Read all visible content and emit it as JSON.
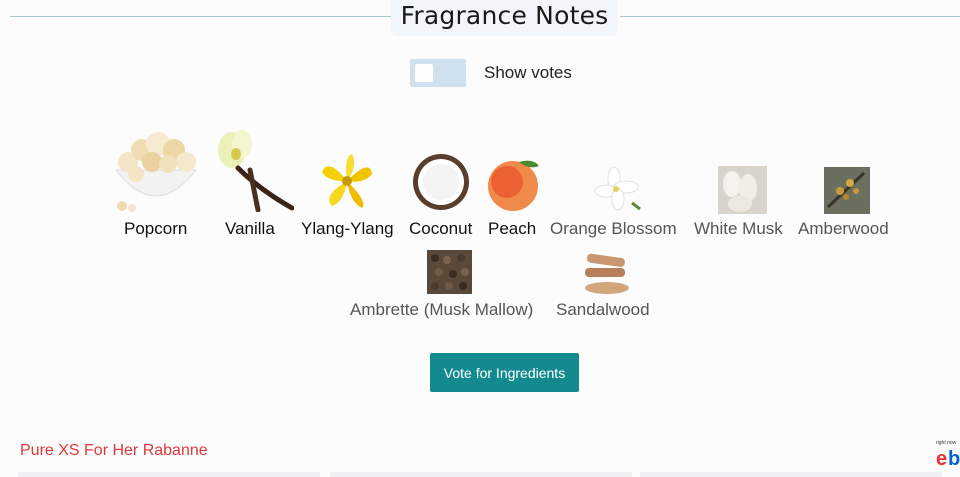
{
  "section": {
    "title": "Fragrance Notes"
  },
  "toggle": {
    "label": "Show votes",
    "checked": false
  },
  "notes": [
    {
      "label": "Popcorn",
      "icon": "popcorn-icon"
    },
    {
      "label": "Vanilla",
      "icon": "vanilla-icon"
    },
    {
      "label": "Ylang-Ylang",
      "icon": "ylang-ylang-icon"
    },
    {
      "label": "Coconut",
      "icon": "coconut-icon"
    },
    {
      "label": "Peach",
      "icon": "peach-icon"
    },
    {
      "label": "Orange Blossom",
      "icon": "orange-blossom-icon"
    },
    {
      "label": "White Musk",
      "icon": "white-musk-icon"
    },
    {
      "label": "Amberwood",
      "icon": "amberwood-icon"
    },
    {
      "label": "Ambrette (Musk Mallow)",
      "icon": "ambrette-icon"
    },
    {
      "label": "Sandalwood",
      "icon": "sandalwood-icon"
    }
  ],
  "actions": {
    "vote_label": "Vote for Ingredients"
  },
  "footer": {
    "link_label": "Pure XS For Her Rabanne",
    "ad_label": "ebay-logo"
  },
  "colors": {
    "accent": "#128a8e",
    "link": "#e03838",
    "toggle_track": "#cfe0ee"
  }
}
